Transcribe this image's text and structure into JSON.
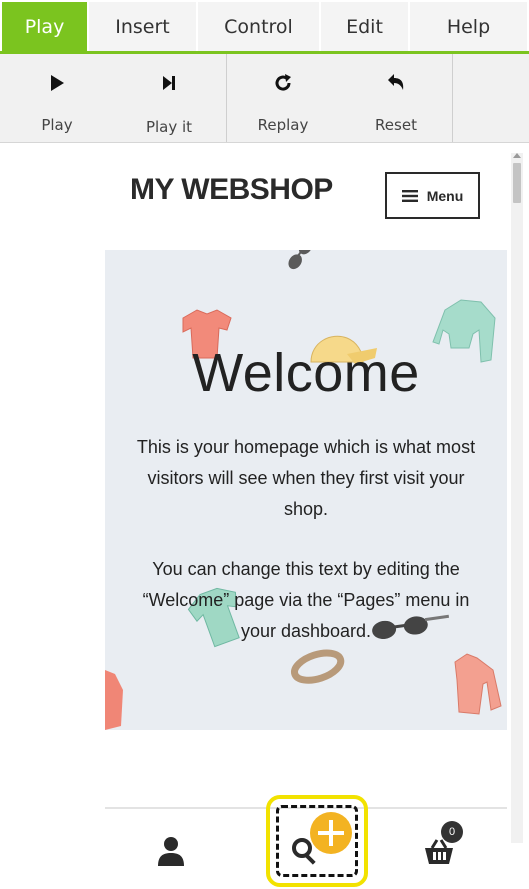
{
  "tabs": [
    {
      "label": "Play",
      "active": true
    },
    {
      "label": "Insert",
      "active": false
    },
    {
      "label": "Control",
      "active": false
    },
    {
      "label": "Edit",
      "active": false
    },
    {
      "label": "Help",
      "active": false
    }
  ],
  "toolbar": {
    "play": {
      "label": "Play",
      "icon": "play-icon"
    },
    "play_it": {
      "label": "Play it",
      "icon": "step-play-icon"
    },
    "replay": {
      "label": "Replay",
      "icon": "replay-icon"
    },
    "reset": {
      "label": "Reset",
      "icon": "reset-icon"
    }
  },
  "site": {
    "brand": "MY WEBSHOP",
    "menu_label": "Menu",
    "hero": {
      "title": "Welcome",
      "paragraph1": "This is your homepage which is what most visitors will see when they first visit your shop.",
      "paragraph2": "You can change this text by editing the “Welcome” page via the “Pages” menu in your dashboard."
    },
    "cart_count": "0"
  },
  "colors": {
    "accent_green": "#7bc41f",
    "highlight_yellow": "#f2e200",
    "plus_orange": "#f3b322",
    "hero_bg": "#e9edf2"
  }
}
